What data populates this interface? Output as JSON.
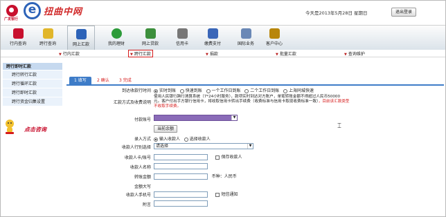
{
  "header": {
    "bank_name": "广发银行",
    "brand": "扭曲中网",
    "e_letter": "e",
    "date_text": "今天是2013年5月28日 星期日",
    "logout_label": "退出登录"
  },
  "nav": [
    {
      "label": "行内查询",
      "color": "#c8102e"
    },
    {
      "label": "跨行查询",
      "color": "#e1b62a"
    },
    {
      "label": "网上汇款",
      "color": "#2d63b8"
    },
    {
      "label": "我的理财",
      "color": "#2d9b3a"
    },
    {
      "label": "网上贷款",
      "color": "#3c8f3c"
    },
    {
      "label": "信用卡",
      "color": "#777777"
    },
    {
      "label": "缴费支付",
      "color": "#3a66b8"
    },
    {
      "label": "国际业务",
      "color": "#6a88b6"
    },
    {
      "label": "客户中心",
      "color": "#b8860b"
    }
  ],
  "subnav": [
    "行内汇款",
    "跨行汇款",
    "捐款",
    "批量汇款",
    "查询维护"
  ],
  "sidebar": {
    "title": "跨行即时汇款",
    "items": [
      "跨行转行汇款",
      "跨行循环汇款",
      "跨行即时汇款",
      "跨行资金归集设置"
    ],
    "consult": "点击咨询"
  },
  "steps": [
    "1 填写",
    "2 确认",
    "3 完成"
  ],
  "form": {
    "arrival_label": "到达收款行时间",
    "arrival_options": [
      "实时到账",
      "快速到账",
      "一个工作日到账",
      "二个工作日到账",
      "上海同城快速"
    ],
    "fee_label": "汇款方式及收费说明",
    "fee_text1": "使用人民银行跨行清算系统（7*24小时服务），款项实时到达对方账户，单笔转账金额不得超过人民币50000",
    "fee_text2": "元。客户付出手方银行信用卡，将收取信用卡转出手续费（收费标准与信用卡取现收费标准一致）",
    "fee_red1": "，目前该汇款类型",
    "fee_red2": "不收取手续费。",
    "account_label": "付款账号",
    "balance_btn": "当前余额",
    "entry_label": "录入方式",
    "entry_options": [
      "输入收款人",
      "选择收款人"
    ],
    "bank_type_label": "收款人行别选择",
    "bank_type_value": "请选择",
    "card_label": "收款人卡/账号",
    "save_payee": "保存收款人",
    "name_label": "收款人名称",
    "amount_label": "转账金额",
    "currency_text": "币种：人民币",
    "amount_upper_label": "金额大写",
    "phone_label": "收款人手机号",
    "sms_label": "短信通知",
    "remark_label": "附言"
  },
  "colors": {
    "brand_red": "#c8102e",
    "step_blue": "#3e7cc8",
    "account_purple": "#8a6bb8"
  }
}
